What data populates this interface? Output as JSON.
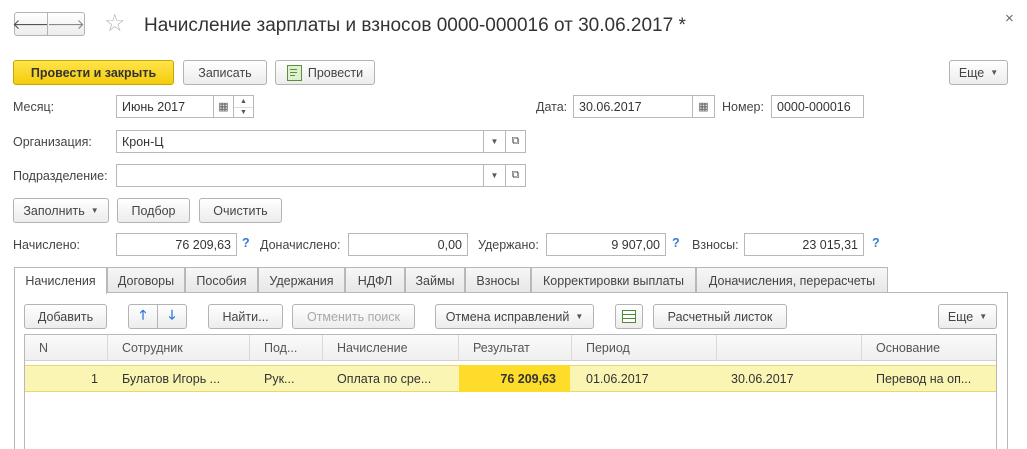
{
  "window": {
    "title": "Начисление зарплаты и взносов 0000-000016 от 30.06.2017 *",
    "back_glyph": "🡐",
    "forward_glyph": "🡒",
    "star_glyph": "☆",
    "close_glyph": "×"
  },
  "toolbar": {
    "post_close_label": "Провести и закрыть",
    "save_label": "Записать",
    "post_label": "Провести",
    "more_label": "Еще"
  },
  "header": {
    "month_label": "Месяц:",
    "month_value": "Июнь 2017",
    "date_label": "Дата:",
    "date_value": "30.06.2017",
    "number_label": "Номер:",
    "number_value": "0000-000016",
    "org_label": "Организация:",
    "org_value": "Крон-Ц",
    "dept_label": "Подразделение:",
    "dept_value": ""
  },
  "actions": {
    "fill_label": "Заполнить",
    "pick_label": "Подбор",
    "clear_label": "Очистить"
  },
  "totals": {
    "accrued_label": "Начислено:",
    "accrued_value": "76 209,63",
    "extra_label": "Доначислено:",
    "extra_value": "0,00",
    "withheld_label": "Удержано:",
    "withheld_value": "9 907,00",
    "contrib_label": "Взносы:",
    "contrib_value": "23 015,31",
    "help_glyph": "?"
  },
  "tabs": [
    {
      "label": "Начисления",
      "active": true
    },
    {
      "label": "Договоры"
    },
    {
      "label": "Пособия"
    },
    {
      "label": "Удержания"
    },
    {
      "label": "НДФЛ"
    },
    {
      "label": "Займы"
    },
    {
      "label": "Взносы"
    },
    {
      "label": "Корректировки выплаты"
    },
    {
      "label": "Доначисления, перерасчеты"
    }
  ],
  "table_toolbar": {
    "add_label": "Добавить",
    "find_label": "Найти...",
    "cancel_search_label": "Отменить поиск",
    "cancel_fix_label": "Отмена исправлений",
    "payslip_label": "Расчетный листок",
    "more_label": "Еще"
  },
  "table": {
    "columns": [
      "N",
      "Сотрудник",
      "Под...",
      "Начисление",
      "Результат",
      "Период",
      "",
      "Основание"
    ],
    "rows": [
      [
        "1",
        "Булатов Игорь ...",
        "Рук...",
        "Оплата по сре...",
        "76 209,63",
        "01.06.2017",
        "30.06.2017",
        "Перевод на оп..."
      ]
    ]
  },
  "colors": {
    "accent_yellow": "#f4cc0c",
    "row_highlight": "#fbf5b4",
    "result_cell": "#fddd2a",
    "help_blue": "#3a7ad0"
  }
}
